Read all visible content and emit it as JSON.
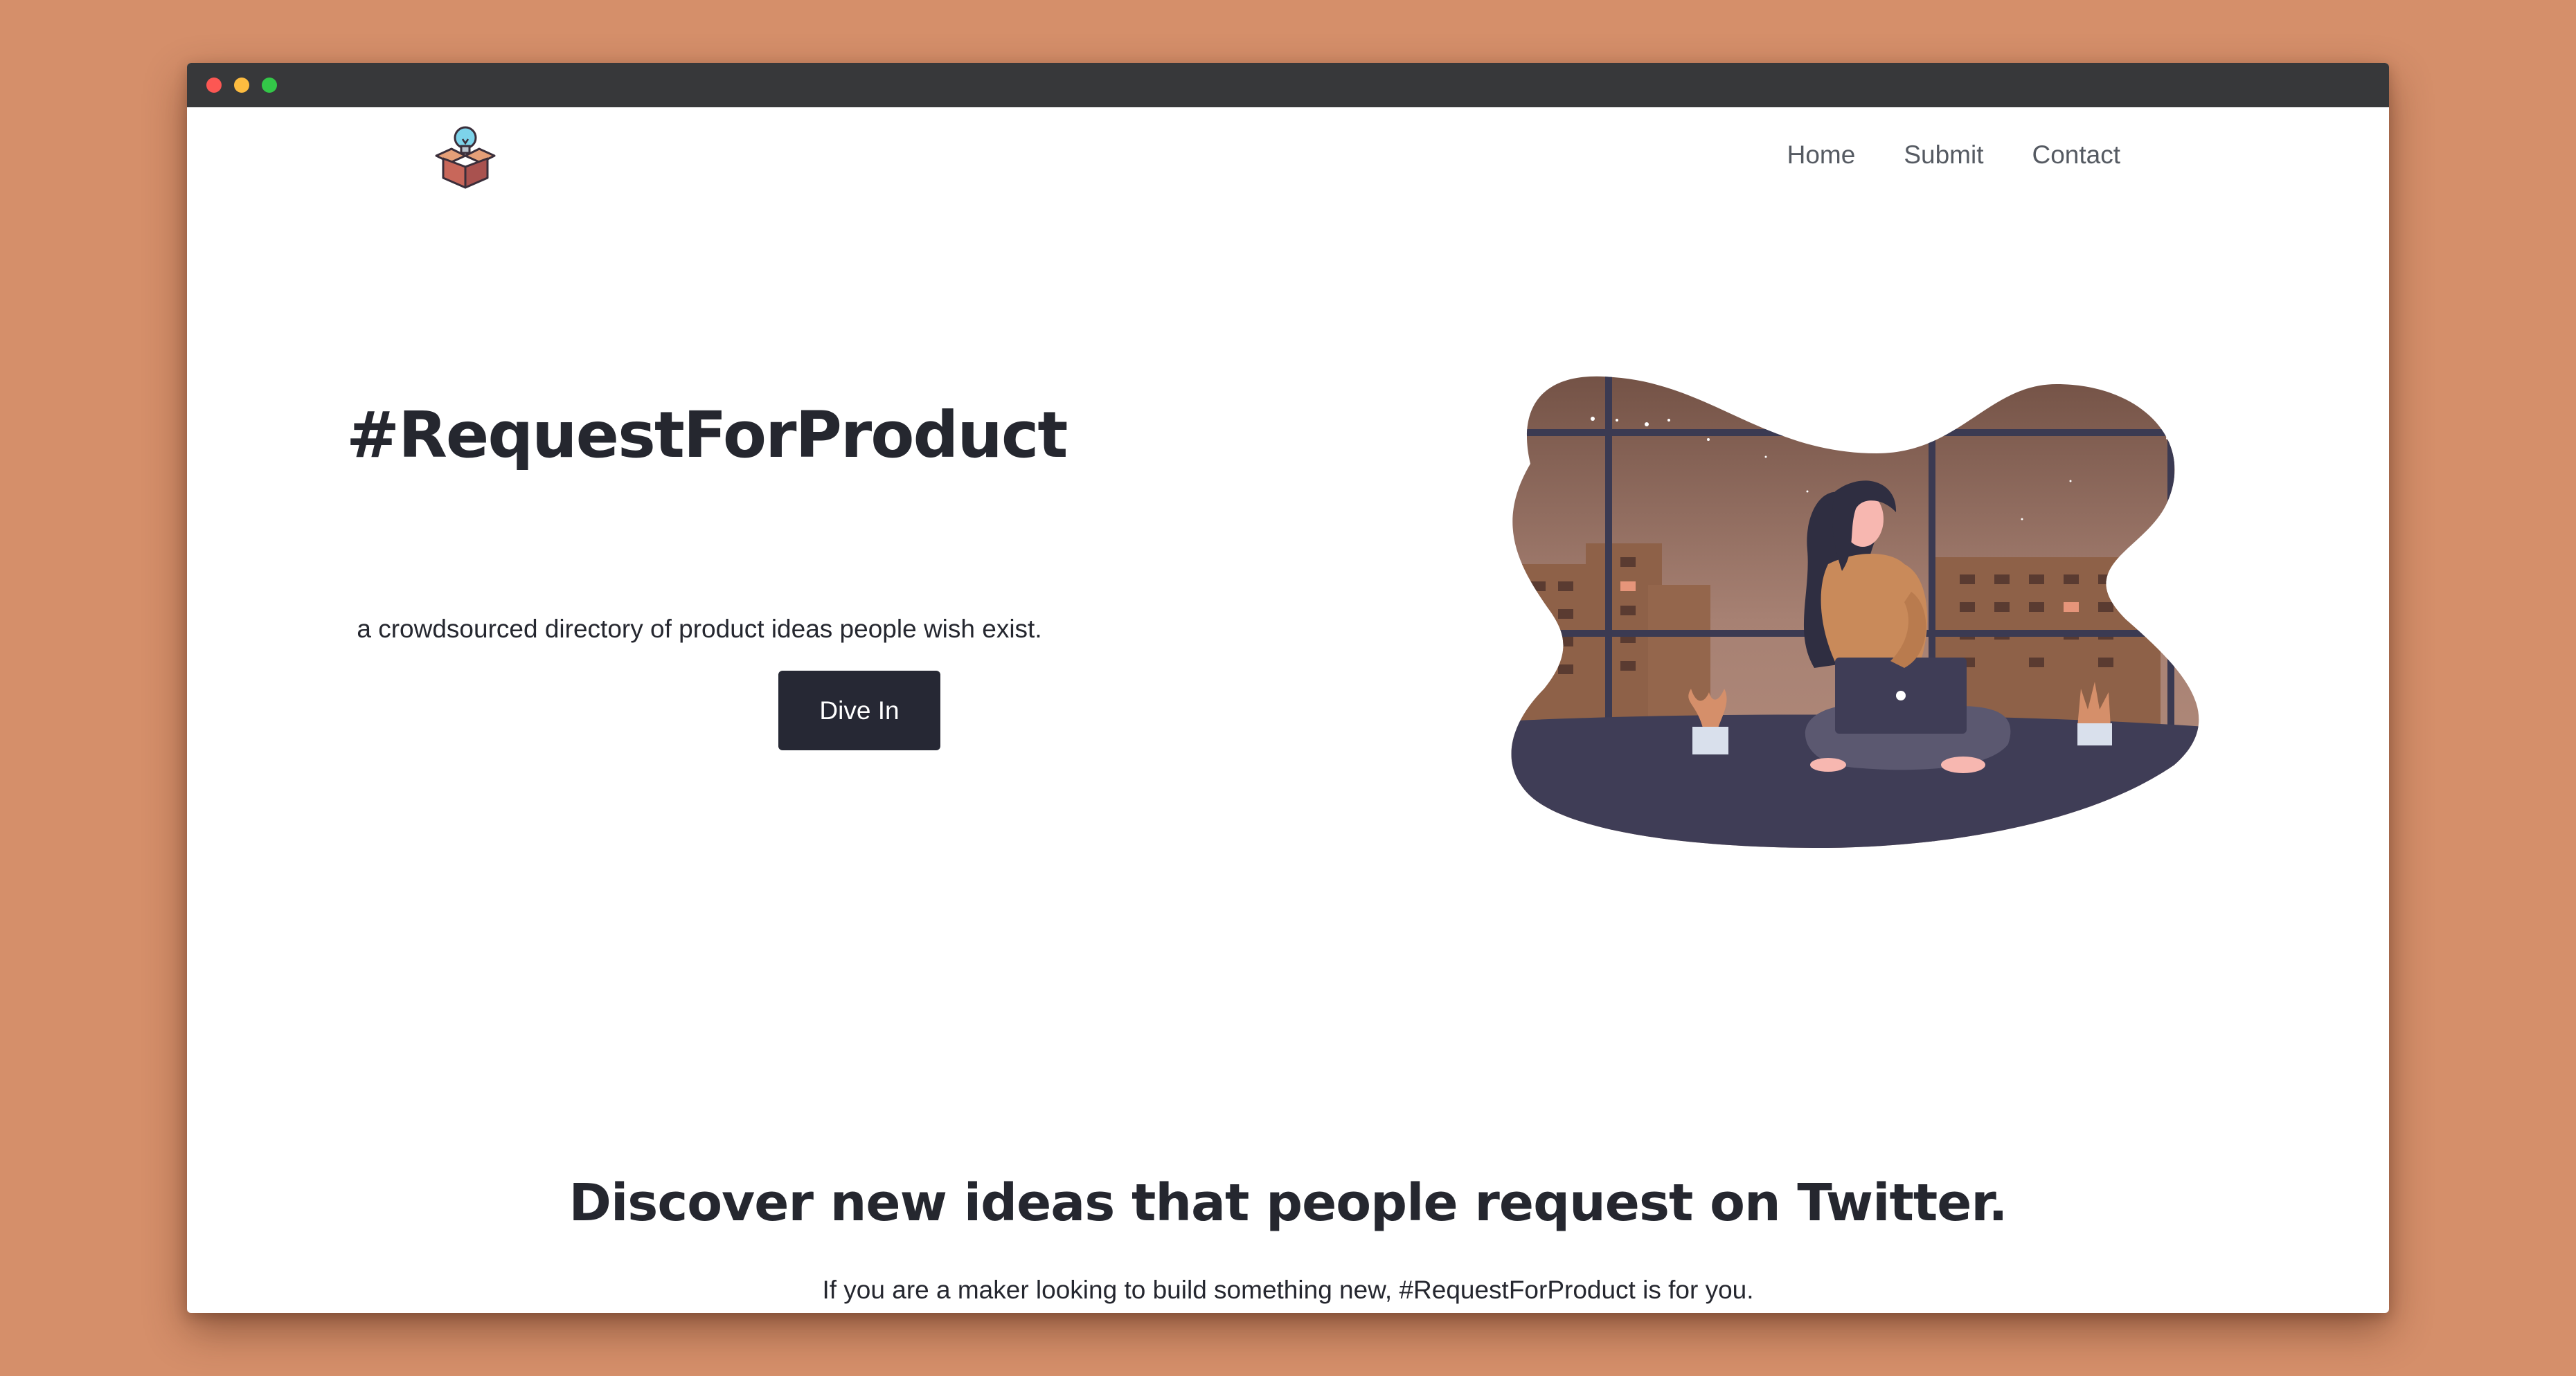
{
  "nav": {
    "items": [
      {
        "label": "Home"
      },
      {
        "label": "Submit"
      },
      {
        "label": "Contact"
      }
    ]
  },
  "hero": {
    "title": "#RequestForProduct",
    "subtitle": "a crowdsourced directory of product ideas people wish exist.",
    "cta_label": "Dive In"
  },
  "discover": {
    "title": "Discover new ideas that people request on Twitter.",
    "subtitle": "If you are a maker looking to build something new, #RequestForProduct is for you."
  },
  "icons": {
    "logo": "box-lightbulb-icon",
    "illustration": "woman-with-laptop-illustration"
  },
  "colors": {
    "background": "#d58f6a",
    "titlebar": "#37383a",
    "text_dark": "#25272f",
    "button": "#262834",
    "nav_text": "#555a62"
  }
}
